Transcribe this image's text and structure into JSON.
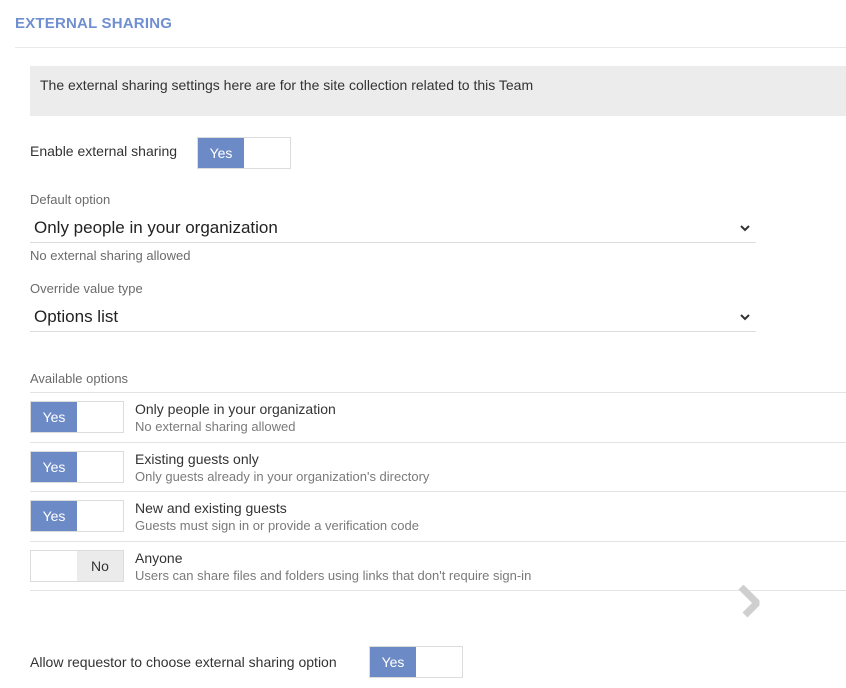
{
  "section": {
    "title": "EXTERNAL SHARING"
  },
  "info": {
    "text": "The external sharing settings here are for the site collection related to this Team"
  },
  "enable_sharing": {
    "label": "Enable external sharing",
    "toggle_on_label": "Yes",
    "value": true
  },
  "default_option": {
    "label": "Default option",
    "selected": "Only people in your organization",
    "help": "No external sharing allowed"
  },
  "override_type": {
    "label": "Override value type",
    "selected": "Options list"
  },
  "available": {
    "label": "Available options",
    "options": [
      {
        "title": "Only people in your organization",
        "subtitle": "No external sharing allowed",
        "enabled": true,
        "toggle_label": "Yes"
      },
      {
        "title": "Existing guests only",
        "subtitle": "Only guests already in your organization's directory",
        "enabled": true,
        "toggle_label": "Yes"
      },
      {
        "title": "New and existing guests",
        "subtitle": "Guests must sign in or provide a verification code",
        "enabled": true,
        "toggle_label": "Yes"
      },
      {
        "title": "Anyone",
        "subtitle": "Users can share files and folders using links that don't require sign-in",
        "enabled": false,
        "toggle_label": "No"
      }
    ]
  },
  "requestor_choice": {
    "label": "Allow requestor to choose external sharing option",
    "toggle_on_label": "Yes",
    "value": true
  },
  "icons": {
    "select_chevron": "chevron-down-icon",
    "nav": "chevron-right-icon"
  },
  "colors": {
    "accent": "#6c8ac6",
    "title": "#6f8fd0",
    "info_bg": "#ececec"
  }
}
